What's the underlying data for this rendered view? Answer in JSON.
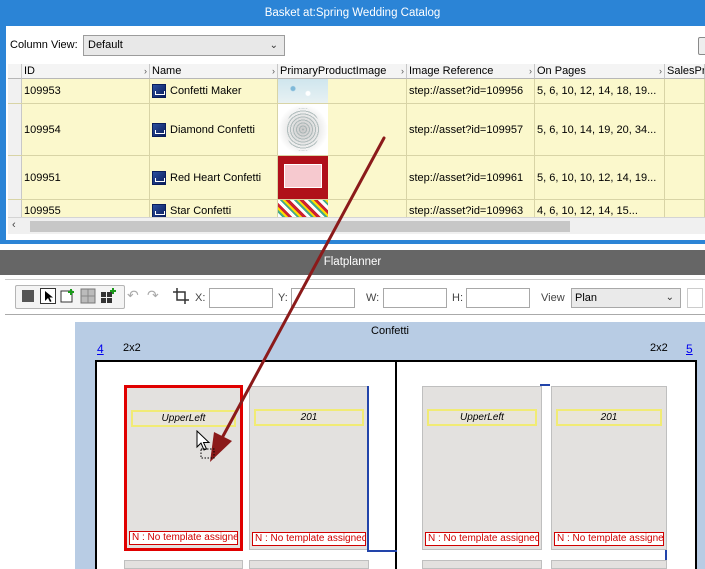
{
  "basket": {
    "title": "Basket at:Spring Wedding Catalog",
    "column_view_label": "Column View:",
    "column_view_value": "Default",
    "columns": [
      "ID",
      "Name",
      "PrimaryProductImage",
      "Image Reference",
      "On Pages",
      "SalesPric"
    ],
    "rows": [
      {
        "id": "109953",
        "name": "Confetti Maker",
        "image_ref": "step://asset?id=109956",
        "on_pages": "5, 6, 10, 12, 14, 18, 19..."
      },
      {
        "id": "109954",
        "name": "Diamond Confetti",
        "image_ref": "step://asset?id=109957",
        "on_pages": "5, 6, 10, 14, 19, 20, 34..."
      },
      {
        "id": "109951",
        "name": "Red Heart Confetti",
        "image_ref": "step://asset?id=109961",
        "on_pages": "5, 6, 10, 10, 12, 14, 19..."
      },
      {
        "id": "109955",
        "name": "Star Confetti",
        "image_ref": "step://asset?id=109963",
        "on_pages": "4, 6, 10, 12, 14, 15..."
      }
    ]
  },
  "flatplanner": {
    "title": "Flatplanner",
    "x_label": "X:",
    "y_label": "Y:",
    "w_label": "W:",
    "h_label": "H:",
    "view_label": "View",
    "view_value": "Plan",
    "spread_title": "Confetti",
    "left_page_num": "4",
    "right_page_num": "5",
    "left_grid": "2x2",
    "right_grid": "2x2",
    "slots": [
      {
        "label": "UpperLeft",
        "warning": "N : No template assigned"
      },
      {
        "label": "201",
        "warning": "N : No template assigned"
      },
      {
        "label": "UpperLeft",
        "warning": "N : No template assigned"
      },
      {
        "label": "201",
        "warning": "N : No template assigned"
      }
    ]
  },
  "colors": {
    "basket_title_bg": "#2b84d6",
    "flatplanner_title_bg": "#666666",
    "row_bg": "#fbf8cc",
    "spread_bg": "#b8cce4",
    "selected_border": "#e00000",
    "drag_arrow": "#8b1a1a"
  }
}
